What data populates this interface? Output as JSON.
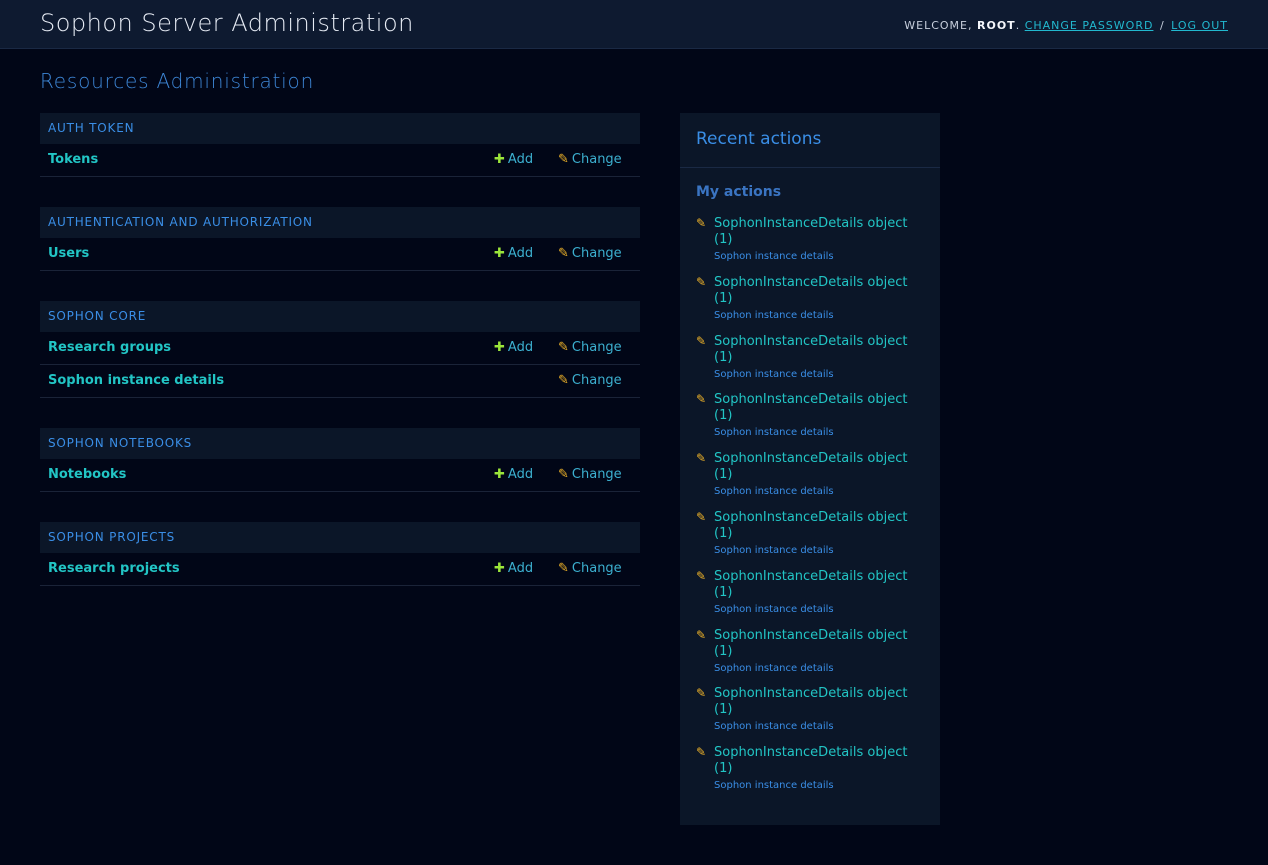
{
  "header": {
    "site_name": "Sophon Server Administration",
    "welcome": "Welcome,",
    "username": "root",
    "change_password": "Change password",
    "separator": "/",
    "logout": "Log out"
  },
  "page": {
    "title": "Resources Administration"
  },
  "modules": [
    {
      "caption": "Auth Token",
      "models": [
        {
          "name": "Tokens",
          "add": "Add",
          "change": "Change"
        }
      ]
    },
    {
      "caption": "Authentication and Authorization",
      "models": [
        {
          "name": "Users",
          "add": "Add",
          "change": "Change"
        }
      ]
    },
    {
      "caption": "Sophon Core",
      "models": [
        {
          "name": "Research groups",
          "add": "Add",
          "change": "Change"
        },
        {
          "name": "Sophon instance details",
          "change": "Change"
        }
      ]
    },
    {
      "caption": "Sophon Notebooks",
      "models": [
        {
          "name": "Notebooks",
          "add": "Add",
          "change": "Change"
        }
      ]
    },
    {
      "caption": "Sophon Projects",
      "models": [
        {
          "name": "Research projects",
          "add": "Add",
          "change": "Change"
        }
      ]
    }
  ],
  "recent_actions": {
    "title": "Recent actions",
    "subtitle": "My actions",
    "items": [
      {
        "label": "SophonInstanceDetails object (1)",
        "type": "Sophon instance details",
        "icon": "pencil-icon"
      },
      {
        "label": "SophonInstanceDetails object (1)",
        "type": "Sophon instance details",
        "icon": "pencil-icon"
      },
      {
        "label": "SophonInstanceDetails object (1)",
        "type": "Sophon instance details",
        "icon": "pencil-icon"
      },
      {
        "label": "SophonInstanceDetails object (1)",
        "type": "Sophon instance details",
        "icon": "pencil-icon"
      },
      {
        "label": "SophonInstanceDetails object (1)",
        "type": "Sophon instance details",
        "icon": "pencil-icon"
      },
      {
        "label": "SophonInstanceDetails object (1)",
        "type": "Sophon instance details",
        "icon": "pencil-icon"
      },
      {
        "label": "SophonInstanceDetails object (1)",
        "type": "Sophon instance details",
        "icon": "pencil-icon"
      },
      {
        "label": "SophonInstanceDetails object (1)",
        "type": "Sophon instance details",
        "icon": "pencil-icon"
      },
      {
        "label": "SophonInstanceDetails object (1)",
        "type": "Sophon instance details",
        "icon": "pencil-icon"
      },
      {
        "label": "SophonInstanceDetails object (1)",
        "type": "Sophon instance details",
        "icon": "pencil-icon"
      }
    ]
  },
  "icons": {
    "add": "plus-icon",
    "change": "pencil-icon"
  },
  "colors": {
    "background": "#010617",
    "header": "#0e1a30",
    "accent": "#3a8ee6",
    "link": "#22c5c5",
    "add_icon": "#9be53a",
    "change_icon": "#f0b429"
  }
}
